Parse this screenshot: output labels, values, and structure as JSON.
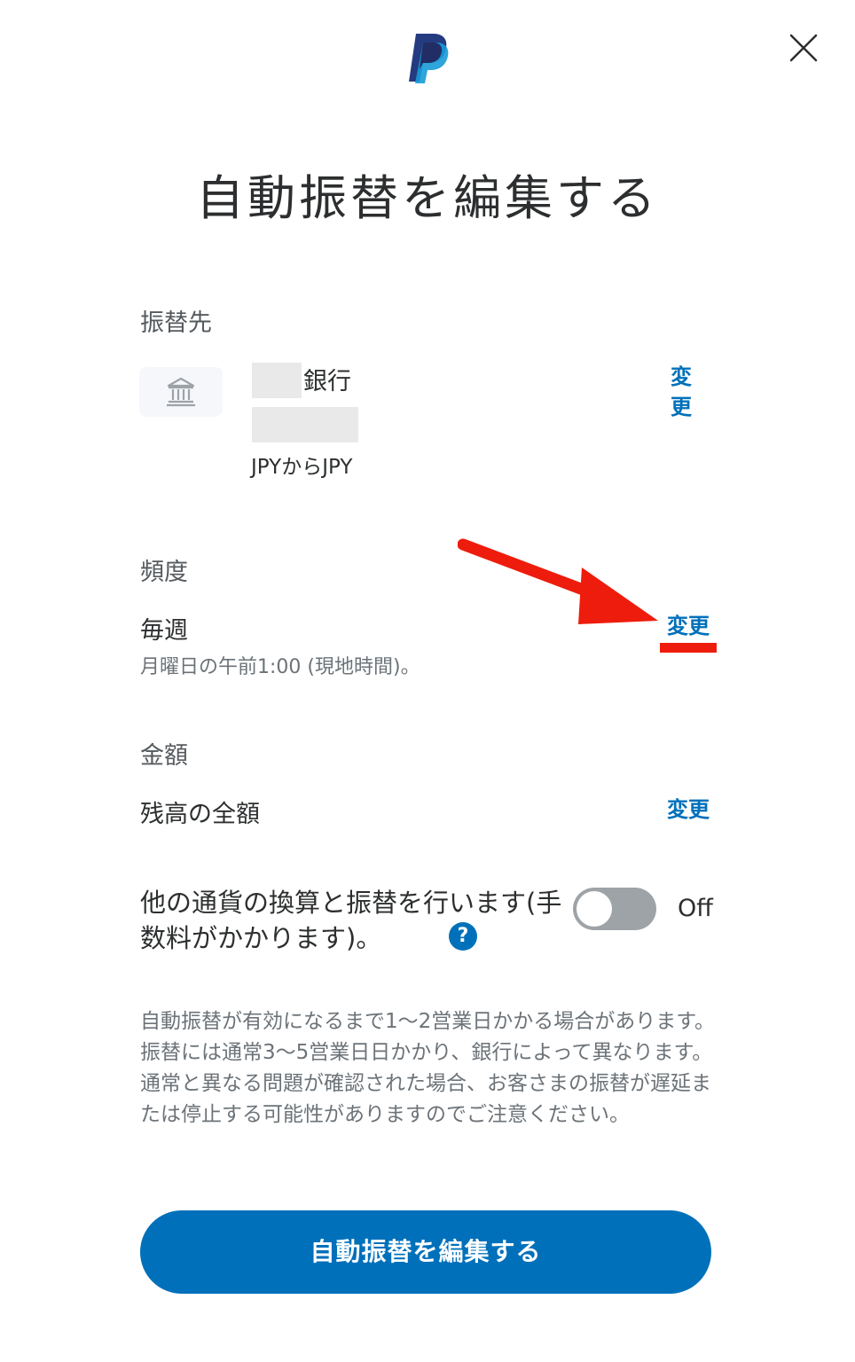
{
  "header": {
    "logo_icon": "paypal-logo",
    "close_icon": "close-icon"
  },
  "title": "自動振替を編集する",
  "destination": {
    "label": "振替先",
    "bank_icon": "bank-icon",
    "bank_name_suffix": "銀行",
    "currency": "JPYからJPY",
    "change_label": "変更"
  },
  "frequency": {
    "label": "頻度",
    "value": "毎週",
    "detail": "月曜日の午前1:00 (現地時間)。",
    "change_label": "変更"
  },
  "amount": {
    "label": "金額",
    "value": "残高の全額",
    "change_label": "変更"
  },
  "convert": {
    "text": "他の通貨の換算と振替を行います(手数料がかかります)。",
    "help_icon": "question-icon",
    "toggle_state": "Off"
  },
  "notice": "自動振替が有効になるまで1〜2営業日かかる場合があります。振替には通常3〜5営業日日かかり、銀行によって異なります。通常と異なる問題が確認された場合、お客さまの振替が遅延または停止する可能性がありますのでご注意ください。",
  "primary_button": "自動振替を編集する",
  "colors": {
    "accent": "#0070ba",
    "annotation": "#ee1c0c",
    "toggle_off": "#9da3a6"
  }
}
